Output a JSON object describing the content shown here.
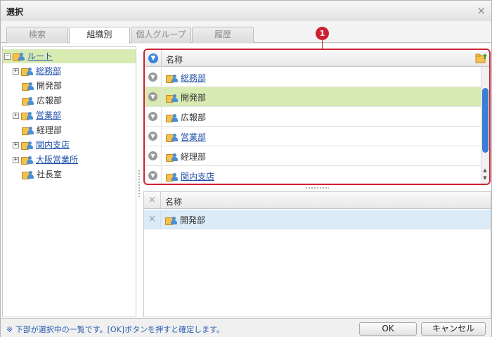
{
  "dialog": {
    "title": "選択",
    "close_label": "×"
  },
  "tabs": [
    {
      "label": "検索"
    },
    {
      "label": "組織別"
    },
    {
      "label": "個人グループ"
    },
    {
      "label": "履歴"
    }
  ],
  "tree": {
    "expand_symbol": "+",
    "collapse_symbol": "−",
    "root": "ルート",
    "items": [
      {
        "label": "総務部",
        "has_children": true,
        "link": true
      },
      {
        "label": "開発部",
        "has_children": false,
        "link": false
      },
      {
        "label": "広報部",
        "has_children": false,
        "link": false
      },
      {
        "label": "営業部",
        "has_children": true,
        "link": true
      },
      {
        "label": "経理部",
        "has_children": false,
        "link": false
      },
      {
        "label": "関内支店",
        "has_children": true,
        "link": true
      },
      {
        "label": "大阪営業所",
        "has_children": true,
        "link": true
      },
      {
        "label": "社長室",
        "has_children": false,
        "link": false
      }
    ]
  },
  "candidates": {
    "header": "名称",
    "badge": "1",
    "rows": [
      {
        "label": "総務部",
        "link": true
      },
      {
        "label": "開発部",
        "link": false,
        "selected": true
      },
      {
        "label": "広報部",
        "link": false
      },
      {
        "label": "営業部",
        "link": true
      },
      {
        "label": "経理部",
        "link": false
      },
      {
        "label": "関内支店",
        "link": true
      }
    ]
  },
  "selected_list": {
    "header": "名称",
    "rows": [
      {
        "label": "開発部"
      }
    ]
  },
  "footer": {
    "hint": "※ 下部が選択中の一覧です。[OK]ボタンを押すと確定します。",
    "ok_label": "OK",
    "cancel_label": "キャンセル"
  },
  "colors": {
    "accent_red": "#cc2233",
    "selection_green": "#d8ebb3",
    "selection_blue": "#dcebf8",
    "link_blue": "#1f4fa8"
  }
}
